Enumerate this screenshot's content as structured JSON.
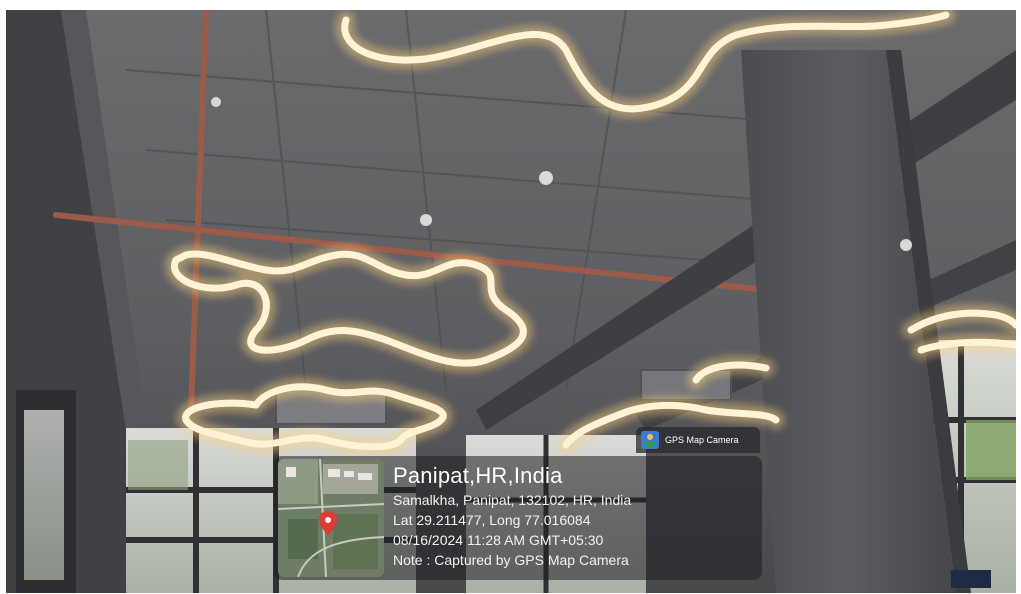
{
  "watermark": {
    "app_label": "GPS Map Camera",
    "app_icon": "gps-map-camera-icon",
    "location_title": "Panipat,HR,India",
    "address": "Samalkha, Panipat, 132102, HR, India",
    "coordinates": "Lat 29.211477, Long 77.016084",
    "datetime": "08/16/2024 11:28 AM GMT+05:30",
    "note": "Note : Captured by GPS Map Camera"
  },
  "colors": {
    "light_glow": "#fff3d6",
    "ceiling": "#5a5c60",
    "duct": "#9c5a48",
    "map_pin": "#e03a32"
  }
}
